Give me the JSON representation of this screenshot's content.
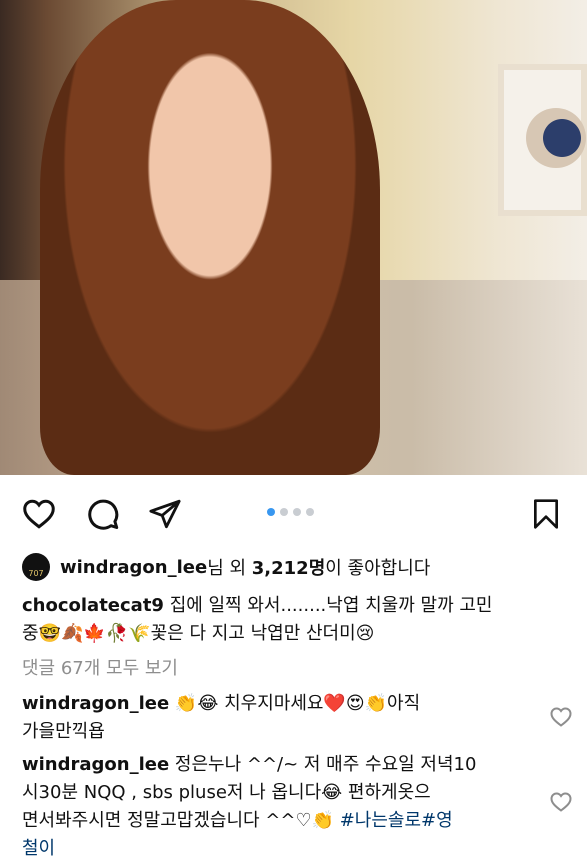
{
  "post": {
    "likes": {
      "username": "windragon_lee",
      "text_a": "님 외 ",
      "count": "3,212명",
      "text_b": "이 좋아합니다",
      "avatar_text": "707"
    },
    "caption": {
      "username": "chocolatecat9",
      "line1": " 집에 일찍 와서........낙엽 치울까 말까 고민",
      "line2": "중🤓🍂🍁🥀🌾꽃은 다 지고 낙엽만 산더미😢"
    },
    "view_comments": "댓글 67개 모두 보기",
    "comments": [
      {
        "username": "windragon_lee",
        "line1": " 👏😂 치우지마세요❤️😍👏아직",
        "line2": "가을만끽욥"
      },
      {
        "username": "windragon_lee",
        "line1": " 정은누나 ^^/~ 저 매주 수요일 저녁10",
        "line2": "시30분 NQQ , sbs pluse저 나 옵니다😂 편하게옷으",
        "line3a": "면서봐주시면 정말고맙겠습니다 ^^♡👏 ",
        "tags": "#나는솔로#영",
        "line4": "철이"
      }
    ]
  },
  "carousel": {
    "count": 4,
    "active_index": 0
  },
  "icons": [
    "heart-icon",
    "comment-icon",
    "share-icon",
    "bookmark-icon",
    "comment-like-icon"
  ]
}
